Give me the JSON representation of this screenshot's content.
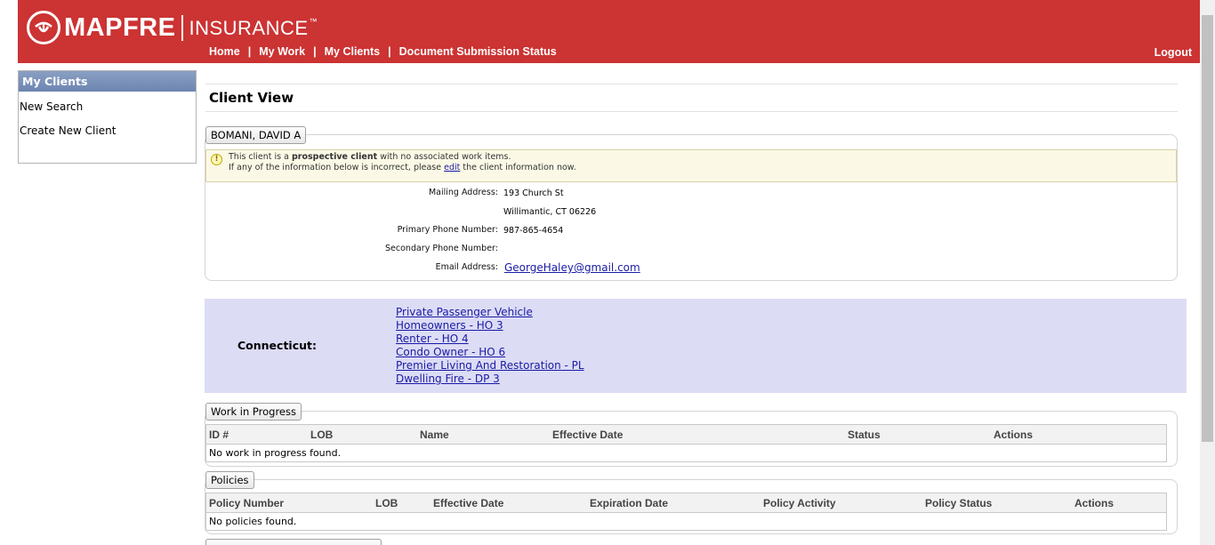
{
  "header": {
    "brand": "MAPFRE",
    "brand_sub": "INSURANCE",
    "trademark": "™",
    "nav": [
      "Home",
      "My Work",
      "My Clients",
      "Document Submission Status"
    ],
    "separator": "|",
    "logout": "Logout",
    "color": "#cc3333"
  },
  "sidebar": {
    "title": "My Clients",
    "items": [
      "New Search",
      "Create New Client"
    ]
  },
  "main": {
    "title": "Client View",
    "client_name": "BOMANI, DAVID A",
    "notice": {
      "line1_pre": "This client is a ",
      "line1_bold": "prospective client",
      "line1_post": " with no associated work items.",
      "line2_pre": "If any of the information below is incorrect, please ",
      "line2_link": "edit",
      "line2_post": " the client information now."
    },
    "info": {
      "mailing_label": "Mailing Address:",
      "mailing_line1": "193 Church St",
      "mailing_line2": "Willimantic, CT 06226",
      "primary_label": "Primary Phone Number:",
      "primary_value": "987-865-4654",
      "secondary_label": "Secondary Phone Number:",
      "secondary_value": "",
      "email_label": "Email Address:",
      "email_value": "GeorgeHaley@gmail.com"
    },
    "state": {
      "label": "Connecticut:",
      "lobs": [
        "Private Passenger Vehicle",
        "Homeowners - HO 3",
        "Renter - HO 4",
        "Condo Owner - HO 6",
        "Premier Living And Restoration - PL",
        "Dwelling Fire - DP 3"
      ],
      "bg": "#dcdcf5"
    },
    "work_in_progress": {
      "legend": "Work in Progress",
      "columns": [
        "ID #",
        "LOB",
        "Name",
        "Effective Date",
        "Status",
        "Actions"
      ],
      "empty": "No work in progress found."
    },
    "policies": {
      "legend": "Policies",
      "columns": [
        "Policy Number",
        "LOB",
        "Effective Date",
        "Expiration Date",
        "Policy Activity",
        "Policy Status",
        "Actions"
      ],
      "empty": "No policies found."
    }
  }
}
